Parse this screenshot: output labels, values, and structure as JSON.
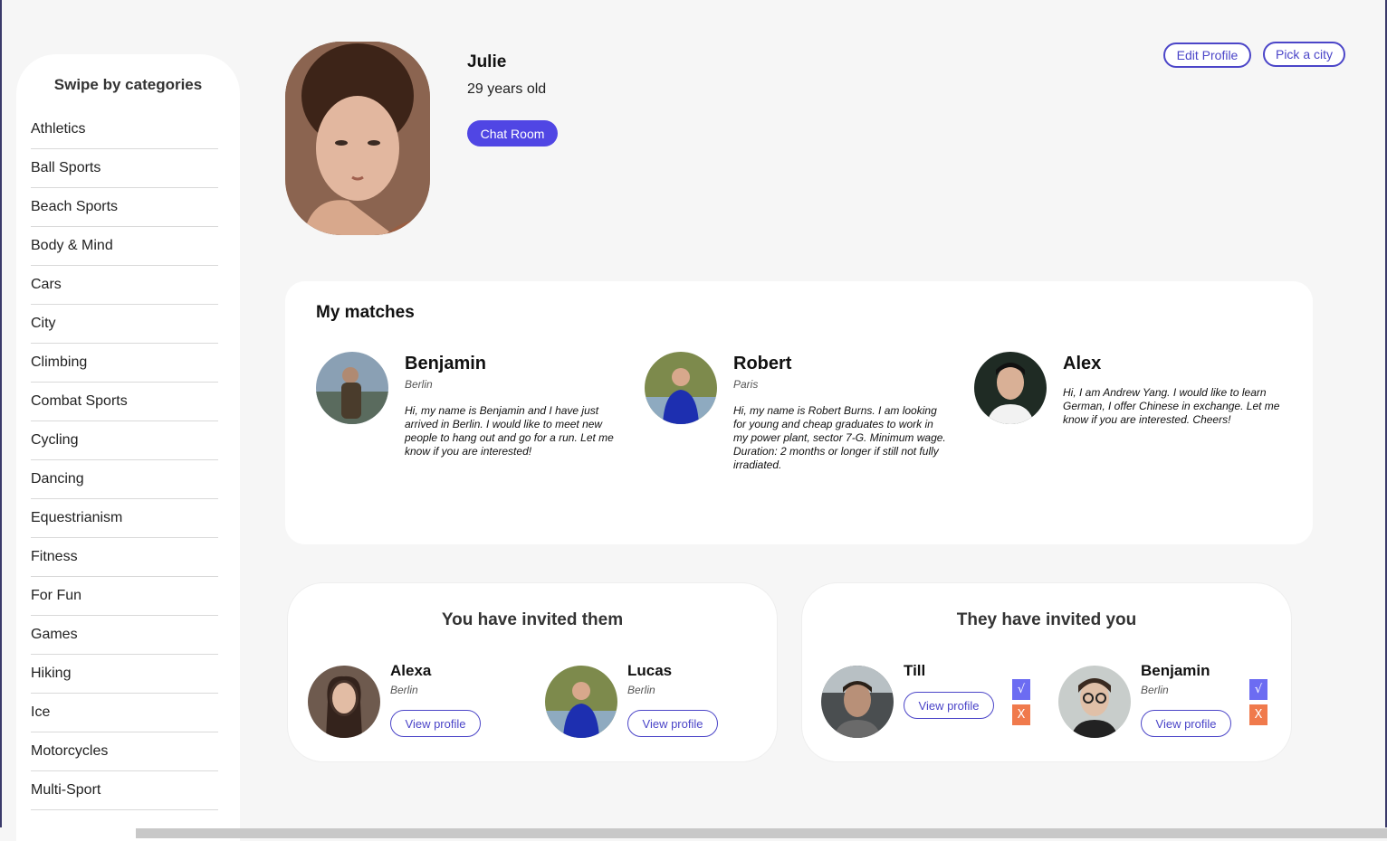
{
  "sidebar": {
    "title": "Swipe by categories",
    "categories": [
      "Athletics",
      "Ball Sports",
      "Beach Sports",
      "Body & Mind",
      "Cars",
      "City",
      "Climbing",
      "Combat Sports",
      "Cycling",
      "Dancing",
      "Equestrianism",
      "Fitness",
      "For Fun",
      "Games",
      "Hiking",
      "Ice",
      "Motorcycles",
      "Multi-Sport"
    ]
  },
  "profile": {
    "name": "Julie",
    "age": "29 years old",
    "chat_button": "Chat Room",
    "edit_button": "Edit Profile",
    "city_button": "Pick a city"
  },
  "matches": {
    "title": "My matches",
    "items": [
      {
        "name": "Benjamin",
        "city": "Berlin",
        "bio": "Hi, my name is Benjamin and I have just arrived in Berlin. I would like to meet new people to hang out and go for a run. Let me know if you are interested!"
      },
      {
        "name": "Robert",
        "city": "Paris",
        "bio": "Hi, my name is Robert Burns. I am looking for young and cheap graduates to work in my power plant, sector 7-G. Minimum wage. Duration: 2 months or longer if still not fully irradiated."
      },
      {
        "name": "Alex",
        "city": "",
        "bio": "Hi, I am Andrew Yang. I would like to learn German, I offer Chinese in exchange. Let me know if you are interested. Cheers!"
      }
    ]
  },
  "sent_invites": {
    "title": "You have invited them",
    "items": [
      {
        "name": "Alexa",
        "city": "Berlin",
        "button": "View profile"
      },
      {
        "name": "Lucas",
        "city": "Berlin",
        "button": "View profile"
      }
    ]
  },
  "received_invites": {
    "title": "They have invited you",
    "items": [
      {
        "name": "Till",
        "city": "",
        "button": "View profile",
        "accept": "√",
        "reject": "X"
      },
      {
        "name": "Benjamin",
        "city": "Berlin",
        "button": "View profile",
        "accept": "√",
        "reject": "X"
      }
    ]
  },
  "colors": {
    "accent": "#5046e4",
    "accept": "#6c6cf2",
    "reject": "#f07a4c",
    "background": "#f6f6f6"
  }
}
